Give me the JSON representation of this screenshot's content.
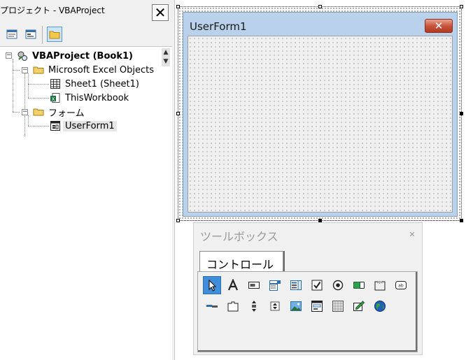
{
  "project_explorer": {
    "title": "プロジェクト - VBAProject",
    "close_glyph": "✕",
    "toolbar": {
      "buttons": [
        {
          "name": "view-code-button",
          "icon": "view-code-icon"
        },
        {
          "name": "view-object-button",
          "icon": "view-object-icon"
        },
        {
          "name": "toggle-folders-button",
          "icon": "folder-icon",
          "active": true
        }
      ]
    },
    "tree": {
      "root": {
        "label": "VBAProject (Book1)",
        "icon": "vbaproject-icon",
        "expanded": true
      },
      "excel_objects": {
        "label": "Microsoft Excel Objects",
        "icon": "folder-icon",
        "expanded": true
      },
      "sheet1": {
        "label": "Sheet1 (Sheet1)",
        "icon": "worksheet-icon"
      },
      "thisworkbook": {
        "label": "ThisWorkbook",
        "icon": "workbook-icon"
      },
      "forms": {
        "label": "フォーム",
        "icon": "folder-icon",
        "expanded": true
      },
      "userform1": {
        "label": "UserForm1",
        "icon": "userform-icon",
        "selected": true
      }
    }
  },
  "designer": {
    "userform": {
      "title": "UserForm1",
      "close_glyph": "✕"
    }
  },
  "toolbox": {
    "title": "ツールボックス",
    "close_glyph": "✕",
    "tab_label": "コントロール",
    "tools": [
      {
        "name": "select-objects",
        "icon": "pointer-icon",
        "selected": true
      },
      {
        "name": "label",
        "icon": "label-icon"
      },
      {
        "name": "textbox",
        "icon": "textbox-icon"
      },
      {
        "name": "combobox",
        "icon": "combobox-icon"
      },
      {
        "name": "listbox",
        "icon": "listbox-icon"
      },
      {
        "name": "checkbox",
        "icon": "checkbox-icon"
      },
      {
        "name": "optionbutton",
        "icon": "optionbutton-icon"
      },
      {
        "name": "togglebutton",
        "icon": "togglebutton-icon"
      },
      {
        "name": "frame",
        "icon": "frame-icon"
      },
      {
        "name": "commandbutton",
        "icon": "commandbutton-icon"
      },
      {
        "name": "tabstrip",
        "icon": "tabstrip-icon"
      },
      {
        "name": "multipage",
        "icon": "multipage-icon"
      },
      {
        "name": "scrollbar",
        "icon": "scrollbar-icon"
      },
      {
        "name": "spinbutton",
        "icon": "spinbutton-icon"
      },
      {
        "name": "image",
        "icon": "image-icon"
      },
      {
        "name": "refedit",
        "icon": "refedit-icon"
      },
      {
        "name": "additional-control-1",
        "icon": "grid-control-icon"
      },
      {
        "name": "additional-control-2",
        "icon": "edit-control-icon"
      },
      {
        "name": "additional-control-3",
        "icon": "globe-icon"
      }
    ]
  }
}
